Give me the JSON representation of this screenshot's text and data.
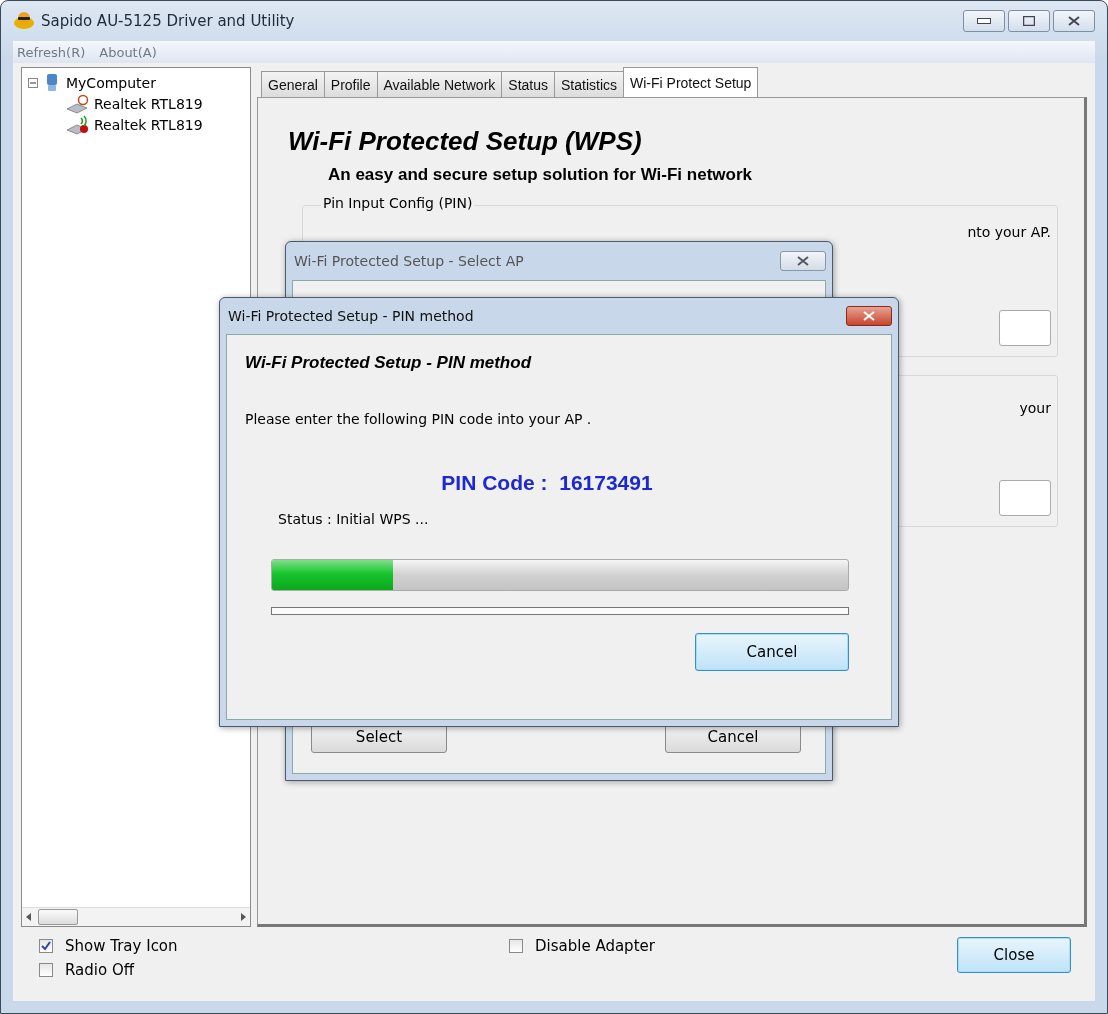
{
  "window": {
    "title": "Sapido AU-5125 Driver and Utility"
  },
  "menu": [
    "Refresh(R)",
    "About(A)"
  ],
  "tree": {
    "label": "MyComputer",
    "expanded": true,
    "children": [
      {
        "label": "Realtek RTL819",
        "kind": "idle"
      },
      {
        "label": "Realtek RTL819",
        "kind": "connected"
      }
    ]
  },
  "tabs": [
    {
      "label": "General",
      "selected": false
    },
    {
      "label": "Profile",
      "selected": false
    },
    {
      "label": "Available Network",
      "selected": false
    },
    {
      "label": "Status",
      "selected": false
    },
    {
      "label": "Statistics",
      "selected": false
    },
    {
      "label": "Wi-Fi Protect Setup",
      "selected": true
    }
  ],
  "wps": {
    "title": "Wi-Fi Protected Setup (WPS)",
    "subtitle": "An easy and secure setup solution for Wi-Fi network",
    "groups": [
      {
        "legend": "Pin Input Config (PIN)",
        "text": "nto your AP."
      },
      {
        "text": "your"
      }
    ]
  },
  "select_ap_dialog": {
    "title": "Wi-Fi Protected Setup - Select AP",
    "buttons": [
      "Select",
      "Cancel"
    ]
  },
  "pin_dialog": {
    "title": "Wi-Fi Protected Setup - PIN method",
    "heading": "Wi-Fi Protected Setup - PIN method",
    "instruction": "Please enter the following PIN code into your AP .",
    "pin_label": "PIN Code :",
    "pin": "16173491",
    "status": "Status : Initial WPS ...",
    "level": 0.21,
    "button": "Cancel"
  },
  "footer": {
    "checkboxes": [
      {
        "label": "Show Tray Icon",
        "checked": true
      },
      {
        "label": "Radio Off",
        "checked": false
      },
      {
        "label": "Disable Adapter",
        "checked": false
      }
    ],
    "close": "Close"
  }
}
